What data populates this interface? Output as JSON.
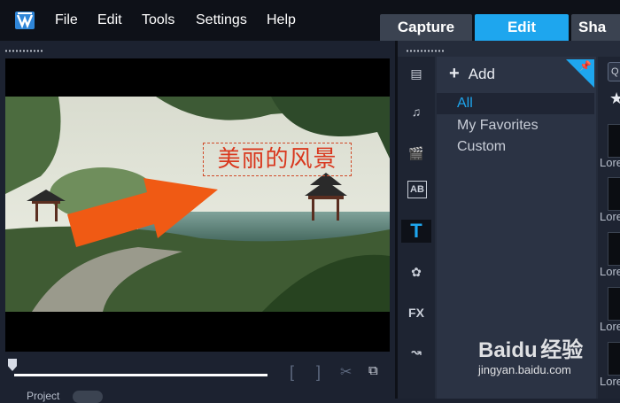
{
  "menu": {
    "file": "File",
    "edit": "Edit",
    "tools": "Tools",
    "settings": "Settings",
    "help": "Help"
  },
  "tabs": {
    "capture": "Capture",
    "edit": "Edit",
    "share": "Sha"
  },
  "player": {
    "title_text": "美丽的风景",
    "project_label": "Project",
    "progress": 0.0
  },
  "library": {
    "add_label": "Add",
    "categories": [
      "All",
      "My Favorites",
      "Custom"
    ],
    "selected_category": "All",
    "search_placeholder": "Q",
    "thumb_label": "Lore"
  },
  "tools": {
    "title_glyph": "T",
    "ab_glyph": "AB",
    "fx_glyph": "FX"
  },
  "watermark": {
    "brand": "Baidu",
    "brand_cn": "经验",
    "url": "jingyan.baidu.com"
  },
  "colors": {
    "accent": "#1ea6ee",
    "background": "#1c2230",
    "title_text": "#d9381e"
  }
}
